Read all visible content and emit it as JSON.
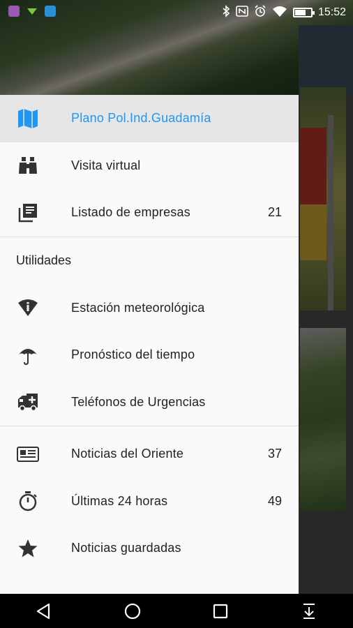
{
  "status_bar": {
    "time": "15:52",
    "battery_level_percent": 70,
    "icons": [
      "notification-app-icon",
      "signal-app-icon",
      "app-icon",
      "bluetooth-icon",
      "nfc-icon",
      "alarm-icon",
      "wifi-icon",
      "battery-icon"
    ]
  },
  "drawer": {
    "main_items": [
      {
        "label": "Plano Pol.Ind.Guadamía",
        "icon": "map-icon",
        "count": "",
        "active": true
      },
      {
        "label": "Visita virtual",
        "icon": "binoculars-icon",
        "count": ""
      },
      {
        "label": "Listado de empresas",
        "icon": "library-books-icon",
        "count": "21"
      }
    ],
    "utilities_header": "Utilidades",
    "utility_items": [
      {
        "label": "Estación meteorológica",
        "icon": "weather-station-icon"
      },
      {
        "label": "Pronóstico del tiempo",
        "icon": "umbrella-icon"
      },
      {
        "label": "Teléfonos de Urgencias",
        "icon": "ambulance-icon"
      }
    ],
    "news_items": [
      {
        "label": "Noticias del Oriente",
        "icon": "newspaper-icon",
        "count": "37"
      },
      {
        "label": "Últimas 24 horas",
        "icon": "timer-icon",
        "count": "49"
      },
      {
        "label": "Noticias guardadas",
        "icon": "star-icon",
        "count": ""
      }
    ]
  },
  "colors": {
    "accent": "#2196f3",
    "active_row": "#e6e6e6",
    "drawer_bg": "#fafafa"
  },
  "nav_bar": {
    "buttons": [
      "back-icon",
      "home-icon",
      "recents-icon",
      "notification-pull-icon"
    ]
  }
}
